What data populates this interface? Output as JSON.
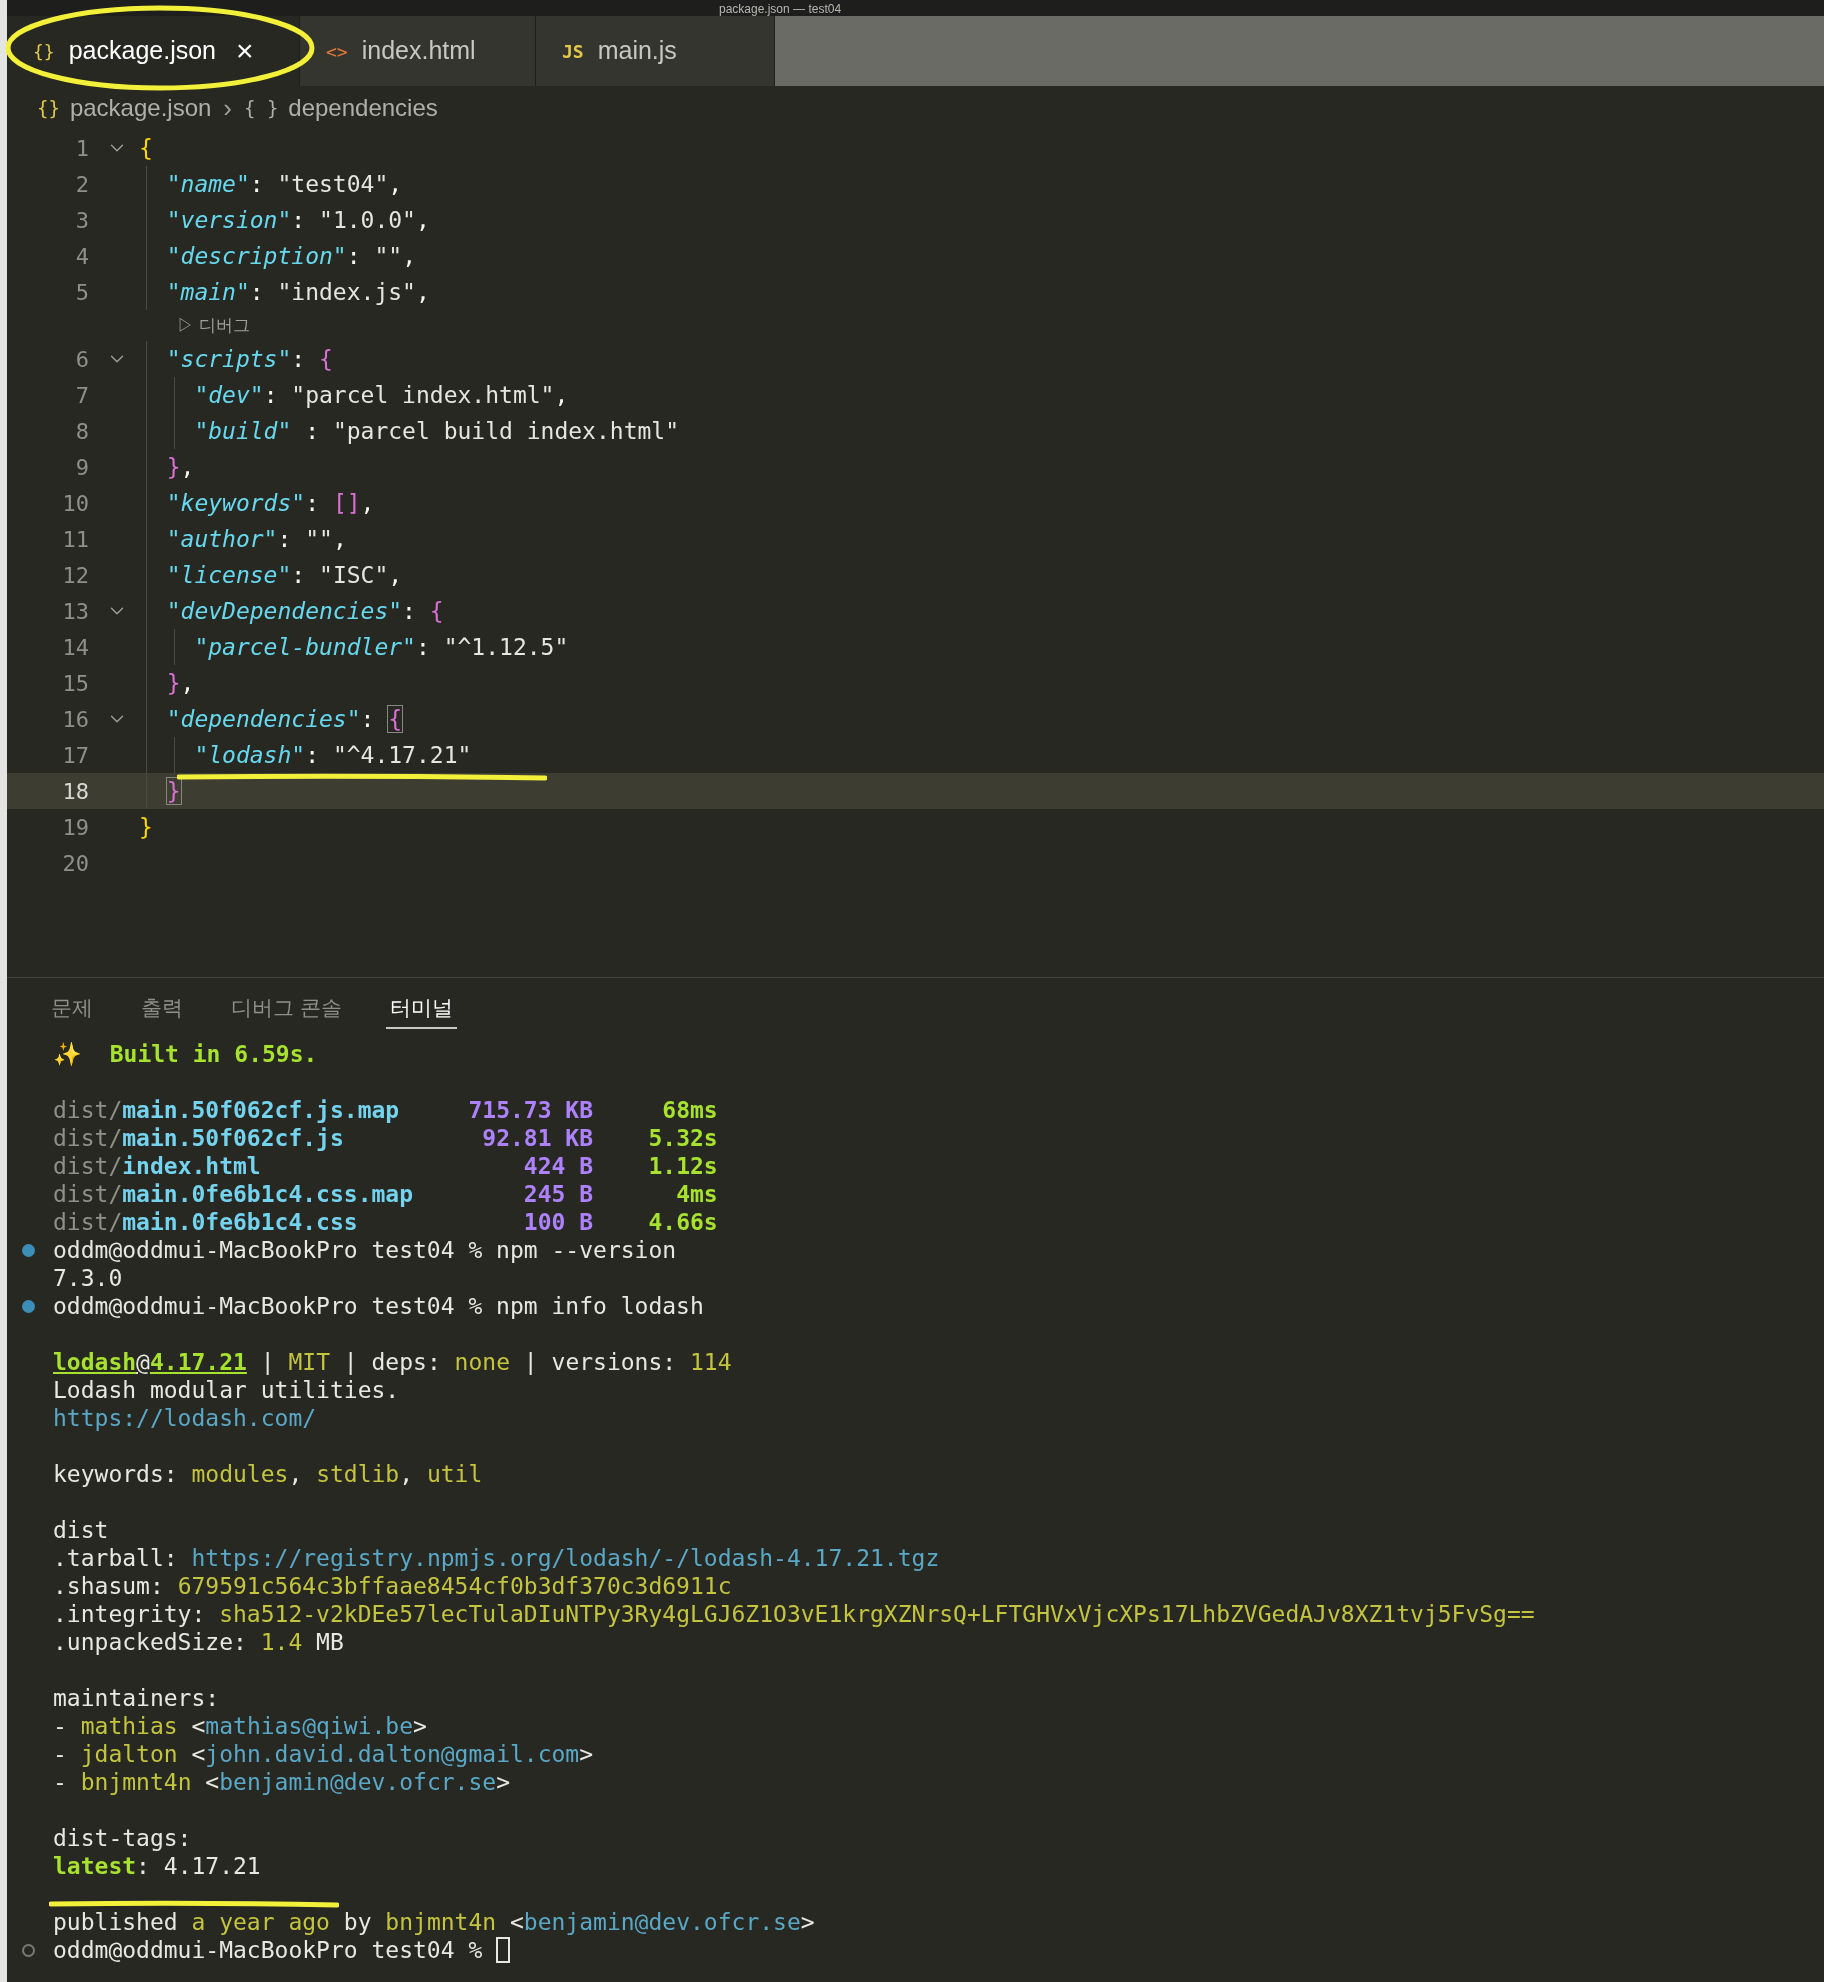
{
  "window": {
    "title": "package.json — test04"
  },
  "tabs": [
    {
      "kind": "json",
      "icon": "{}",
      "label": "package.json",
      "selected": true,
      "close": "×",
      "annotated": true
    },
    {
      "kind": "html",
      "icon": "<>",
      "label": "index.html",
      "selected": false
    },
    {
      "kind": "js",
      "icon": "JS",
      "label": "main.js",
      "selected": false
    }
  ],
  "breadcrumb": [
    {
      "icon": "{}",
      "label": "package.json"
    },
    {
      "separator": "›",
      "icon": "{ }",
      "label": "dependencies"
    }
  ],
  "editor": {
    "lines": [
      {
        "kind": "code",
        "number": "1",
        "fold": true,
        "selected": false,
        "tokens": [
          {
            "kind": "b1",
            "text": "{"
          }
        ]
      },
      {
        "kind": "code",
        "number": "2",
        "fold": false,
        "selected": false,
        "tokens": [
          {
            "kind": "key",
            "text": "  \"name\""
          },
          {
            "kind": "p",
            "text": ": "
          },
          {
            "kind": "str",
            "text": "\"test04\""
          },
          {
            "kind": "p",
            "text": ","
          }
        ]
      },
      {
        "kind": "code",
        "number": "3",
        "fold": false,
        "selected": false,
        "tokens": [
          {
            "kind": "key",
            "text": "  \"version\""
          },
          {
            "kind": "p",
            "text": ": "
          },
          {
            "kind": "str",
            "text": "\"1.0.0\""
          },
          {
            "kind": "p",
            "text": ","
          }
        ]
      },
      {
        "kind": "code",
        "number": "4",
        "fold": false,
        "selected": false,
        "tokens": [
          {
            "kind": "key",
            "text": "  \"description\""
          },
          {
            "kind": "p",
            "text": ": "
          },
          {
            "kind": "str",
            "text": "\"\""
          },
          {
            "kind": "p",
            "text": ","
          }
        ]
      },
      {
        "kind": "code",
        "number": "5",
        "fold": false,
        "selected": false,
        "tokens": [
          {
            "kind": "key",
            "text": "  \"main\""
          },
          {
            "kind": "p",
            "text": ": "
          },
          {
            "kind": "str",
            "text": "\"index.js\""
          },
          {
            "kind": "p",
            "text": ","
          }
        ]
      },
      {
        "kind": "codelens",
        "text": "▷ 디버그"
      },
      {
        "kind": "code",
        "number": "6",
        "fold": true,
        "selected": false,
        "tokens": [
          {
            "kind": "key",
            "text": "  \"scripts\""
          },
          {
            "kind": "p",
            "text": ": "
          },
          {
            "kind": "b2",
            "text": "{"
          }
        ]
      },
      {
        "kind": "code",
        "number": "7",
        "fold": false,
        "selected": false,
        "tokens": [
          {
            "kind": "key",
            "text": "    \"dev\""
          },
          {
            "kind": "p",
            "text": ": "
          },
          {
            "kind": "str",
            "text": "\"parcel index.html\""
          },
          {
            "kind": "p",
            "text": ","
          }
        ]
      },
      {
        "kind": "code",
        "number": "8",
        "fold": false,
        "selected": false,
        "tokens": [
          {
            "kind": "key",
            "text": "    \"build\""
          },
          {
            "kind": "p",
            "text": " : "
          },
          {
            "kind": "str",
            "text": "\"parcel build index.html\""
          }
        ]
      },
      {
        "kind": "code",
        "number": "9",
        "fold": false,
        "selected": false,
        "tokens": [
          {
            "kind": "b2",
            "text": "  }"
          },
          {
            "kind": "p",
            "text": ","
          }
        ]
      },
      {
        "kind": "code",
        "number": "10",
        "fold": false,
        "selected": false,
        "tokens": [
          {
            "kind": "key",
            "text": "  \"keywords\""
          },
          {
            "kind": "p",
            "text": ": "
          },
          {
            "kind": "b2",
            "text": "[]"
          },
          {
            "kind": "p",
            "text": ","
          }
        ]
      },
      {
        "kind": "code",
        "number": "11",
        "fold": false,
        "selected": false,
        "tokens": [
          {
            "kind": "key",
            "text": "  \"author\""
          },
          {
            "kind": "p",
            "text": ": "
          },
          {
            "kind": "str",
            "text": "\"\""
          },
          {
            "kind": "p",
            "text": ","
          }
        ]
      },
      {
        "kind": "code",
        "number": "12",
        "fold": false,
        "selected": false,
        "tokens": [
          {
            "kind": "key",
            "text": "  \"license\""
          },
          {
            "kind": "p",
            "text": ": "
          },
          {
            "kind": "str",
            "text": "\"ISC\""
          },
          {
            "kind": "p",
            "text": ","
          }
        ]
      },
      {
        "kind": "code",
        "number": "13",
        "fold": true,
        "selected": false,
        "tokens": [
          {
            "kind": "key",
            "text": "  \"devDependencies\""
          },
          {
            "kind": "p",
            "text": ": "
          },
          {
            "kind": "b2",
            "text": "{"
          }
        ]
      },
      {
        "kind": "code",
        "number": "14",
        "fold": false,
        "selected": false,
        "tokens": [
          {
            "kind": "key",
            "text": "    \"parcel-bundler\""
          },
          {
            "kind": "p",
            "text": ": "
          },
          {
            "kind": "str",
            "text": "\"^1.12.5\""
          }
        ]
      },
      {
        "kind": "code",
        "number": "15",
        "fold": false,
        "selected": false,
        "tokens": [
          {
            "kind": "b2",
            "text": "  }"
          },
          {
            "kind": "p",
            "text": ","
          }
        ]
      },
      {
        "kind": "code",
        "number": "16",
        "fold": true,
        "selected": false,
        "tokens": [
          {
            "kind": "key",
            "text": "  \"dependencies\""
          },
          {
            "kind": "p",
            "text": ": "
          },
          {
            "kind": "b2m",
            "text": "{"
          }
        ]
      },
      {
        "kind": "code",
        "number": "17",
        "fold": false,
        "selected": false,
        "tokens": [
          {
            "kind": "key",
            "text": "    \"lodash\""
          },
          {
            "kind": "p",
            "text": ": "
          },
          {
            "kind": "str",
            "text": "\"^4.17.21\""
          }
        ]
      },
      {
        "kind": "code",
        "number": "18",
        "fold": false,
        "selected": true,
        "annotated": true,
        "tokens": [
          {
            "kind": "b2m",
            "text": "  }"
          }
        ]
      },
      {
        "kind": "code",
        "number": "19",
        "fold": false,
        "selected": false,
        "tokens": [
          {
            "kind": "b1",
            "text": "}"
          }
        ]
      },
      {
        "kind": "code",
        "number": "20",
        "fold": false,
        "selected": false
      }
    ]
  },
  "panel": {
    "tabs": [
      {
        "label": "문제",
        "selected": false
      },
      {
        "label": "출력",
        "selected": false
      },
      {
        "label": "디버그 콘솔",
        "selected": false
      },
      {
        "label": "터미널",
        "selected": true
      }
    ],
    "terminal": [
      {
        "kind": "text",
        "segs": [
          {
            "kind": "emoji",
            "text": "✨"
          },
          {
            "kind": "green",
            "text": "  Built in 6.59s."
          }
        ]
      },
      {
        "kind": "blank"
      },
      {
        "kind": "text",
        "segs": [
          {
            "kind": "dim",
            "text": "dist/"
          },
          {
            "kind": "file",
            "text": "main.50f062cf.js.map"
          },
          {
            "kind": "size",
            "text": "     715.73 KB"
          },
          {
            "kind": "green",
            "text": "     68ms"
          }
        ]
      },
      {
        "kind": "text",
        "segs": [
          {
            "kind": "dim",
            "text": "dist/"
          },
          {
            "kind": "file",
            "text": "main.50f062cf.js"
          },
          {
            "kind": "size",
            "text": "          92.81 KB"
          },
          {
            "kind": "green",
            "text": "    5.32s"
          }
        ]
      },
      {
        "kind": "text",
        "segs": [
          {
            "kind": "dim",
            "text": "dist/"
          },
          {
            "kind": "file",
            "text": "index.html"
          },
          {
            "kind": "size",
            "text": "                   424 B"
          },
          {
            "kind": "green",
            "text": "    1.12s"
          }
        ]
      },
      {
        "kind": "text",
        "segs": [
          {
            "kind": "dim",
            "text": "dist/"
          },
          {
            "kind": "file",
            "text": "main.0fe6b1c4.css.map"
          },
          {
            "kind": "size",
            "text": "        245 B"
          },
          {
            "kind": "green",
            "text": "      4ms"
          }
        ]
      },
      {
        "kind": "text",
        "segs": [
          {
            "kind": "dim",
            "text": "dist/"
          },
          {
            "kind": "file",
            "text": "main.0fe6b1c4.css"
          },
          {
            "kind": "size",
            "text": "            100 B"
          },
          {
            "kind": "green",
            "text": "    4.66s"
          }
        ]
      },
      {
        "kind": "text",
        "status_dot": {
          "filled": true
        },
        "segs": [
          {
            "kind": "plain",
            "text": "oddm@oddmui-MacBookPro test04 % npm --version"
          }
        ]
      },
      {
        "kind": "text",
        "segs": [
          {
            "kind": "plain",
            "text": "7.3.0"
          }
        ]
      },
      {
        "kind": "text",
        "status_dot": {
          "filled": true
        },
        "segs": [
          {
            "kind": "plain",
            "text": "oddm@oddmui-MacBookPro test04 % npm info lodash"
          }
        ]
      },
      {
        "kind": "blank"
      },
      {
        "kind": "text",
        "segs": [
          {
            "kind": "green_u",
            "text": "lodash"
          },
          {
            "kind": "plain_u",
            "text": "@"
          },
          {
            "kind": "green_u",
            "text": "4.17.21"
          },
          {
            "kind": "plain",
            "text": " | "
          },
          {
            "kind": "yellow",
            "text": "MIT"
          },
          {
            "kind": "plain",
            "text": " | deps: "
          },
          {
            "kind": "yellow",
            "text": "none"
          },
          {
            "kind": "plain",
            "text": " | versions: "
          },
          {
            "kind": "yellow",
            "text": "114"
          }
        ]
      },
      {
        "kind": "text",
        "segs": [
          {
            "kind": "plain",
            "text": "Lodash modular utilities."
          }
        ]
      },
      {
        "kind": "text",
        "segs": [
          {
            "kind": "link",
            "text": "https://lodash.com/"
          }
        ]
      },
      {
        "kind": "blank"
      },
      {
        "kind": "text",
        "segs": [
          {
            "kind": "plain",
            "text": "keywords: "
          },
          {
            "kind": "yellow",
            "text": "modules"
          },
          {
            "kind": "plain",
            "text": ", "
          },
          {
            "kind": "yellow",
            "text": "stdlib"
          },
          {
            "kind": "plain",
            "text": ", "
          },
          {
            "kind": "yellow",
            "text": "util"
          }
        ]
      },
      {
        "kind": "blank"
      },
      {
        "kind": "text",
        "segs": [
          {
            "kind": "plain",
            "text": "dist"
          }
        ]
      },
      {
        "kind": "text",
        "segs": [
          {
            "kind": "plain",
            "text": ".tarball: "
          },
          {
            "kind": "link",
            "text": "https://registry.npmjs.org/lodash/-/lodash-4.17.21.tgz"
          }
        ]
      },
      {
        "kind": "text",
        "segs": [
          {
            "kind": "plain",
            "text": ".shasum: "
          },
          {
            "kind": "yellow",
            "text": "679591c564c3bffaae8454cf0b3df370c3d6911c"
          }
        ]
      },
      {
        "kind": "text",
        "segs": [
          {
            "kind": "plain",
            "text": ".integrity: "
          },
          {
            "kind": "yellow",
            "text": "sha512-v2kDEe57lecTulaDIuNTPy3Ry4gLGJ6Z1O3vE1krgXZNrsQ+LFTGHVxVjcXPs17LhbZVGedAJv8XZ1tvj5FvSg=="
          }
        ]
      },
      {
        "kind": "text",
        "segs": [
          {
            "kind": "plain",
            "text": ".unpackedSize: "
          },
          {
            "kind": "yellow",
            "text": "1.4"
          },
          {
            "kind": "plain",
            "text": " MB"
          }
        ]
      },
      {
        "kind": "blank"
      },
      {
        "kind": "text",
        "segs": [
          {
            "kind": "plain",
            "text": "maintainers:"
          }
        ]
      },
      {
        "kind": "text",
        "segs": [
          {
            "kind": "plain",
            "text": "- "
          },
          {
            "kind": "yellow",
            "text": "mathias"
          },
          {
            "kind": "plain",
            "text": " <"
          },
          {
            "kind": "link",
            "text": "mathias@qiwi.be"
          },
          {
            "kind": "plain",
            "text": ">"
          }
        ]
      },
      {
        "kind": "text",
        "segs": [
          {
            "kind": "plain",
            "text": "- "
          },
          {
            "kind": "yellow",
            "text": "jdalton"
          },
          {
            "kind": "plain",
            "text": " <"
          },
          {
            "kind": "link",
            "text": "john.david.dalton@gmail.com"
          },
          {
            "kind": "plain",
            "text": ">"
          }
        ]
      },
      {
        "kind": "text",
        "segs": [
          {
            "kind": "plain",
            "text": "- "
          },
          {
            "kind": "yellow",
            "text": "bnjmnt4n"
          },
          {
            "kind": "plain",
            "text": " <"
          },
          {
            "kind": "link",
            "text": "benjamin@dev.ofcr.se"
          },
          {
            "kind": "plain",
            "text": ">"
          }
        ]
      },
      {
        "kind": "blank"
      },
      {
        "kind": "text",
        "segs": [
          {
            "kind": "plain",
            "text": "dist-tags:"
          }
        ]
      },
      {
        "kind": "text",
        "segs": [
          {
            "kind": "green",
            "text": "latest"
          },
          {
            "kind": "plain",
            "text": ": 4.17.21"
          }
        ]
      },
      {
        "kind": "blank",
        "annotated": true
      },
      {
        "kind": "text",
        "segs": [
          {
            "kind": "plain",
            "text": "published "
          },
          {
            "kind": "yellow",
            "text": "a year ago"
          },
          {
            "kind": "plain",
            "text": " by "
          },
          {
            "kind": "yellow",
            "text": "bnjmnt4n"
          },
          {
            "kind": "plain",
            "text": " <"
          },
          {
            "kind": "link",
            "text": "benjamin@dev.ofcr.se"
          },
          {
            "kind": "plain",
            "text": ">"
          }
        ]
      },
      {
        "kind": "text",
        "status_dot": {
          "filled": false
        },
        "cursor": true,
        "segs": [
          {
            "kind": "plain",
            "text": "oddm@oddmui-MacBookPro test04 % "
          }
        ]
      }
    ]
  }
}
